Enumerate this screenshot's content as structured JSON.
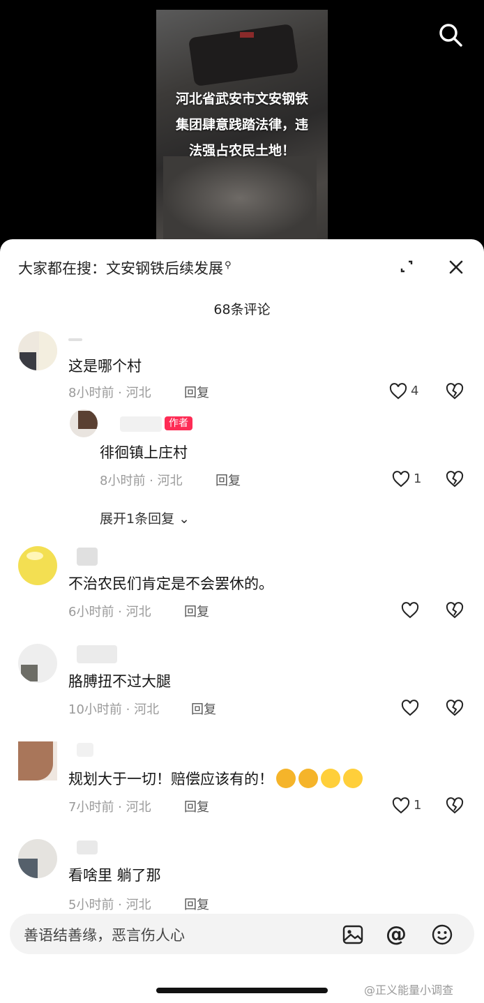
{
  "video": {
    "caption_lines": [
      "河北省武安市文安钢铁",
      "集团肆意践踏法律，违",
      "法强占农民土地！"
    ]
  },
  "sheet": {
    "search_prefix": "大家都在搜：",
    "search_query": "文安钢铁后续发展",
    "comment_count": "68条评论"
  },
  "comments": [
    {
      "text": "这是哪个村",
      "meta": "8小时前 · 河北",
      "reply": "回复",
      "likes": "4"
    },
    {
      "text": "不治农民们肯定是不会罢休的。",
      "meta": "6小时前 · 河北",
      "reply": "回复",
      "likes": ""
    },
    {
      "text": "胳膊扭不过大腿",
      "meta": "10小时前 · 河北",
      "reply": "回复",
      "likes": ""
    },
    {
      "text": "规划大于一切！赔偿应该有的！",
      "meta": "7小时前 · 河北",
      "reply": "回复",
      "likes": "1"
    },
    {
      "text": "看啥里  躺了那",
      "meta": "5小时前 · 河北",
      "reply": "回复",
      "likes": ""
    }
  ],
  "author_reply": {
    "tag": "作者",
    "text": "徘徊镇上庄村",
    "meta": "8小时前 · 河北",
    "reply": "回复",
    "likes": "1",
    "expand": "展开1条回复"
  },
  "input": {
    "placeholder": "善语结善缘，恶言伤人心"
  },
  "watermark": "@正义能量小调查",
  "colors": {
    "accent": "#fe2c55"
  }
}
